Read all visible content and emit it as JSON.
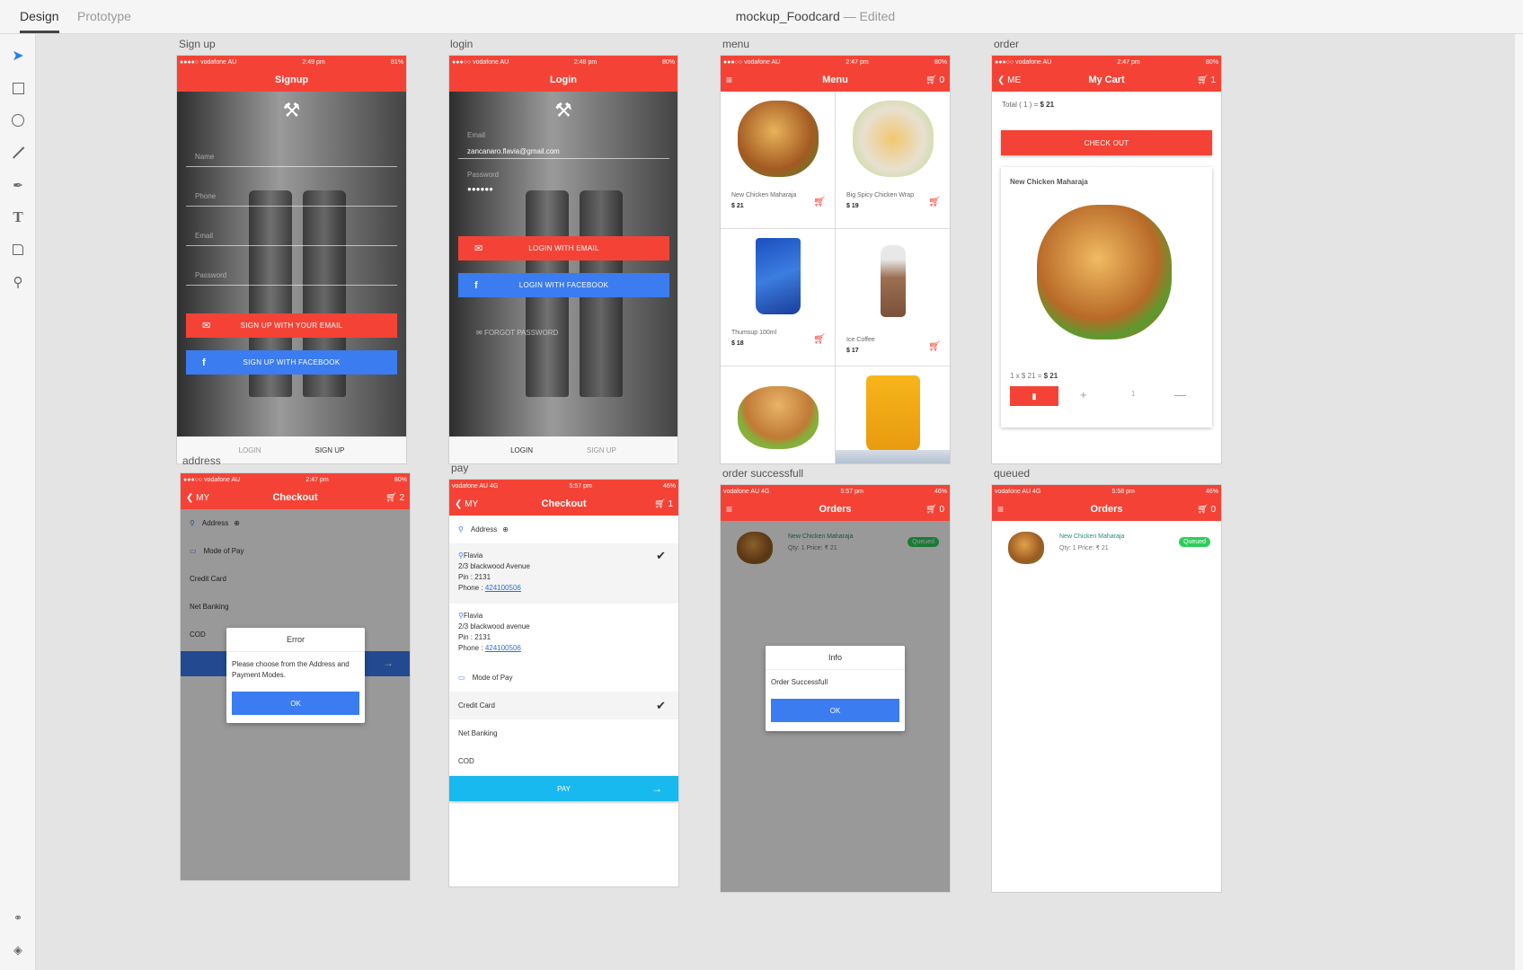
{
  "app": {
    "tabs": [
      {
        "label": "Design",
        "active": true
      },
      {
        "label": "Prototype",
        "active": false
      }
    ],
    "document_title": "mockup_Foodcard",
    "document_state": "Edited",
    "tools": [
      "select-tool",
      "rectangle-tool",
      "ellipse-tool",
      "line-tool",
      "pen-tool",
      "text-tool",
      "artboard-tool",
      "zoom-tool"
    ],
    "bottom_tools": [
      "symbols",
      "layers"
    ]
  },
  "colors": {
    "primary": "#f44336",
    "facebook": "#3b7cf0",
    "pay": "#17b9ee",
    "success": "#2ecc5a"
  },
  "artboards": {
    "signup": {
      "label": "Sign up",
      "status": {
        "carrier": "●●●●○ vodafone AU",
        "time": "2:49 pm",
        "battery": "81%"
      },
      "title": "Signup",
      "fields": [
        "Name",
        "Phone",
        "Email",
        "Password"
      ],
      "email_button": "SIGN UP WITH YOUR EMAIL",
      "facebook_button": "SIGN UP WITH FACEBOOK",
      "tabs": [
        "LOGIN",
        "SIGN UP"
      ]
    },
    "login": {
      "label": "login",
      "status": {
        "carrier": "●●●○○ vodafone AU",
        "time": "2:48 pm",
        "battery": "80%"
      },
      "title": "Login",
      "email_label": "Email",
      "email_value": "zancanaro.flavia@gmail.com",
      "password_label": "Password",
      "password_value": "●●●●●●",
      "email_button": "LOGIN WITH EMAIL",
      "facebook_button": "LOGIN WITH FACEBOOK",
      "forgot": "FORGOT PASSWORD",
      "tabs": [
        "LOGIN",
        "SIGN UP"
      ]
    },
    "menu": {
      "label": "menu",
      "status": {
        "carrier": "●●●○○ vodafone AU",
        "time": "2:47 pm",
        "battery": "80%"
      },
      "title": "Menu",
      "cart_count": "0",
      "items": [
        {
          "name": "New Chicken Maharaja",
          "price": "$ 21",
          "color": "#d98a3a"
        },
        {
          "name": "Big Spicy Chicken Wrap",
          "price": "$ 19",
          "color": "#e7d3b0"
        },
        {
          "name": "Thumsup 100ml",
          "price": "$ 18",
          "color": "#2a5fcf"
        },
        {
          "name": "Ice Coffee",
          "price": "$ 17",
          "color": "#9b7052"
        },
        {
          "name": "",
          "price": "",
          "color": "#d9a256"
        },
        {
          "name": "",
          "price": "",
          "color": "#f0a91c"
        }
      ]
    },
    "order": {
      "label": "order",
      "status": {
        "carrier": "●●●○○ vodafone AU",
        "time": "2:47 pm",
        "battery": "80%"
      },
      "back": "ME",
      "title": "My Cart",
      "cart_count": "1",
      "total_prefix": "Total ( 1 ) = ",
      "total_value": "$ 21",
      "checkout": "CHECK OUT",
      "item_name": "New Chicken Maharaja",
      "line_prefix": "1 x $ 21 = ",
      "line_total": "$ 21",
      "quantity": "1"
    },
    "address": {
      "label": "address",
      "status": {
        "carrier": "●●●○○ vodafone AU",
        "time": "2:47 pm",
        "battery": "80%"
      },
      "back": "MY",
      "title": "Checkout",
      "cart_count": "2",
      "address_label": "Address",
      "mode_label": "Mode of Pay",
      "modes": [
        "Credit Card",
        "Net Banking",
        "COD"
      ],
      "dialog": {
        "title": "Error",
        "message": "Please choose from the Address and Payment Modes.",
        "ok": "OK"
      }
    },
    "pay": {
      "label": "pay",
      "status": {
        "carrier": "vodafone AU  4G",
        "time": "5:57 pm",
        "battery": "46%"
      },
      "back": "MY",
      "title": "Checkout",
      "cart_count": "1",
      "address_label": "Address",
      "addresses": [
        {
          "name": "Flavia",
          "line": "2/3 blackwood Avenue",
          "pin": "Pin : 2131",
          "phone_label": "Phone : ",
          "phone": "424100506",
          "selected": true
        },
        {
          "name": "Flavia",
          "line": "2/3 blackwood avenue",
          "pin": "Pin : 2131",
          "phone_label": "Phone : ",
          "phone": "424100506",
          "selected": false
        }
      ],
      "mode_label": "Mode of Pay",
      "modes": [
        {
          "label": "Credit Card",
          "selected": true
        },
        {
          "label": "Net Banking",
          "selected": false
        },
        {
          "label": "COD",
          "selected": false
        }
      ],
      "pay_button": "PAY"
    },
    "order_success": {
      "label": "order successfull",
      "status": {
        "carrier": "vodafone AU  4G",
        "time": "5:57 pm",
        "battery": "46%"
      },
      "title": "Orders",
      "cart_count": "0",
      "order": {
        "name": "New Chicken Maharaja",
        "meta": "Qty: 1 Price: ₹ 21",
        "badge": "Queued"
      },
      "dialog": {
        "title": "Info",
        "message": "Order Successfull",
        "ok": "OK"
      }
    },
    "queued": {
      "label": "queued",
      "status": {
        "carrier": "vodafone AU  4G",
        "time": "5:58 pm",
        "battery": "46%"
      },
      "title": "Orders",
      "cart_count": "0",
      "order": {
        "name": "New Chicken Maharaja",
        "meta": "Qty: 1 Price: ₹ 21",
        "badge": "Queued"
      }
    }
  }
}
